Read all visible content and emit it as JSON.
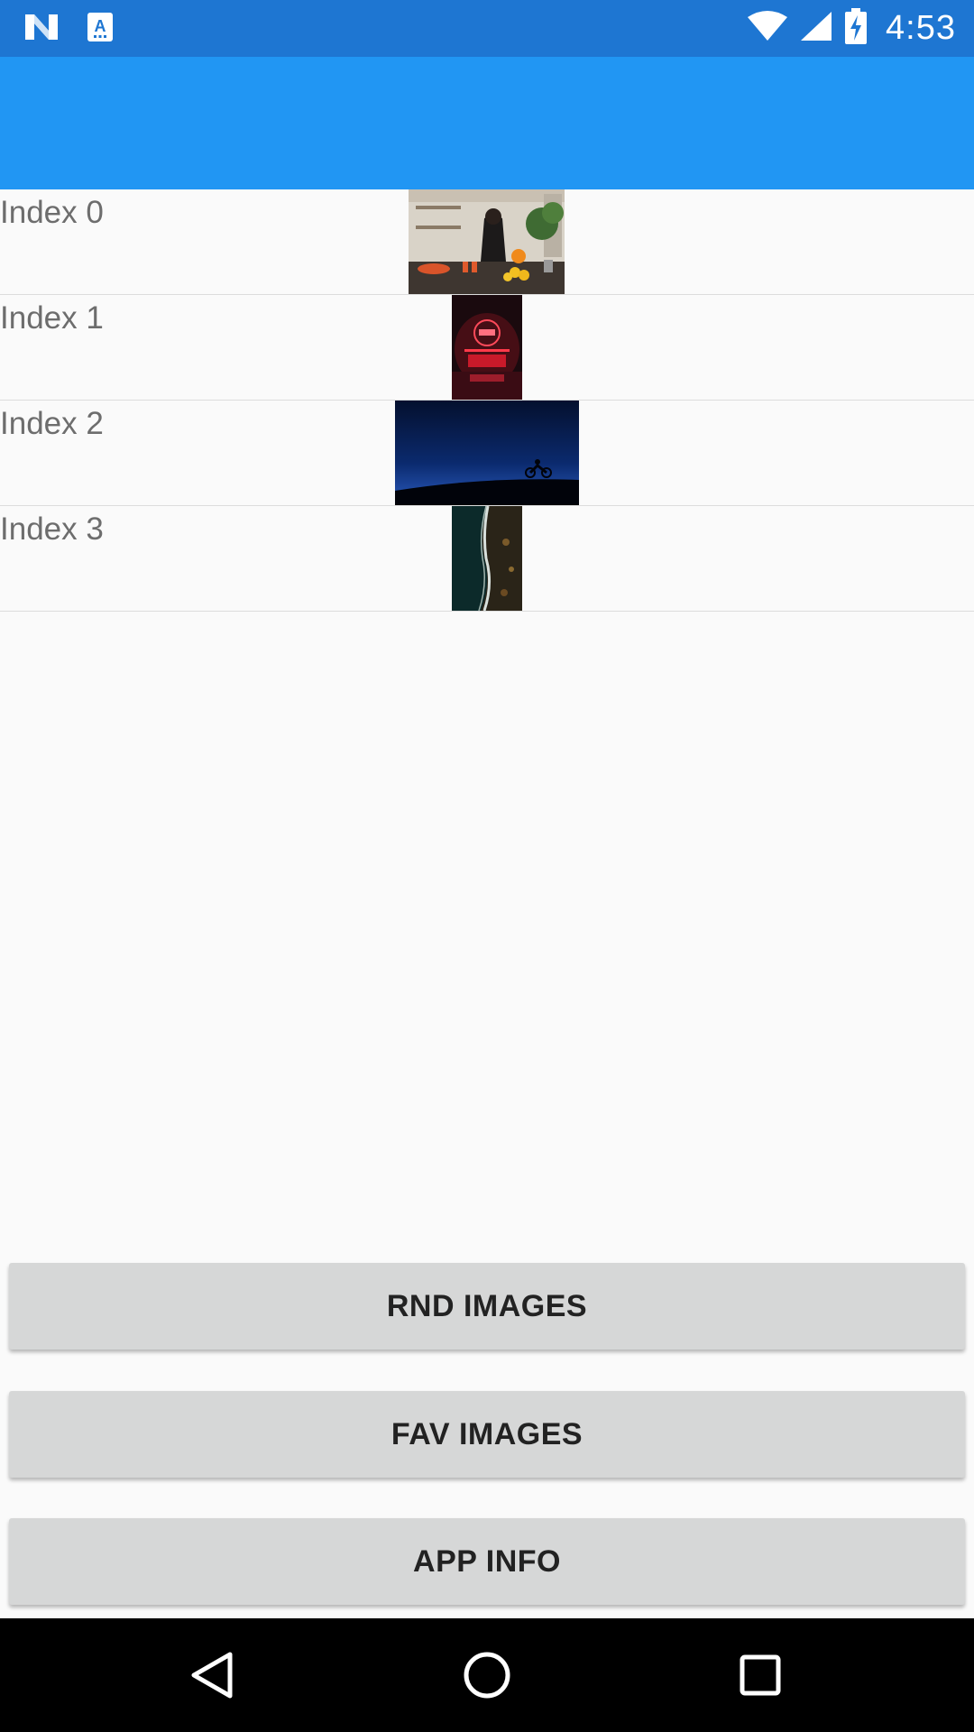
{
  "status_bar": {
    "time": "4:53",
    "icons": [
      "n-notification-icon",
      "a-notification-icon",
      "wifi-icon",
      "signal-icon",
      "battery-charging-icon"
    ],
    "background": "#1e76d2"
  },
  "toolbar": {
    "background": "#2196f3"
  },
  "list": {
    "items": [
      {
        "label": "Index 0",
        "image": "kitchen-photo"
      },
      {
        "label": "Index 1",
        "image": "neon-sign-photo"
      },
      {
        "label": "Index 2",
        "image": "night-motorcycle-photo"
      },
      {
        "label": "Index 3",
        "image": "aerial-coast-photo"
      }
    ]
  },
  "buttons": {
    "rnd_images": "RND IMAGES",
    "fav_images": "FAV IMAGES",
    "app_info": "APP INFO"
  },
  "nav_bar": {
    "icons": [
      "back-icon",
      "home-icon",
      "recents-icon"
    ]
  }
}
